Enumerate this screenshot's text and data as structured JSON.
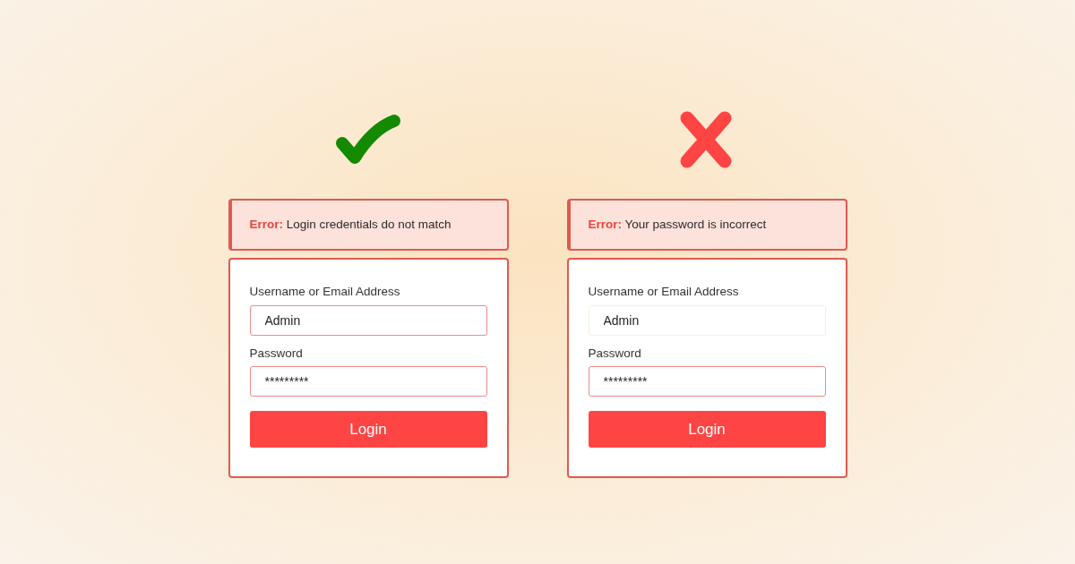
{
  "panels": [
    {
      "kind": "check",
      "alert": "**Error:** Login credentials do not match",
      "fields": [
        {
          "label": "Username or Email Address",
          "value": "Admin",
          "invalid": true
        },
        {
          "label": "Password",
          "value": "*********",
          "invalid": true
        }
      ],
      "button": "Login"
    },
    {
      "kind": "cross",
      "alert": "**Error:** Your password is incorrect",
      "fields": [
        {
          "label": "Username or Email Address",
          "value": "Admin",
          "invalid": false
        },
        {
          "label": "Password",
          "value": "*********",
          "invalid": true
        }
      ],
      "button": "Login"
    }
  ]
}
